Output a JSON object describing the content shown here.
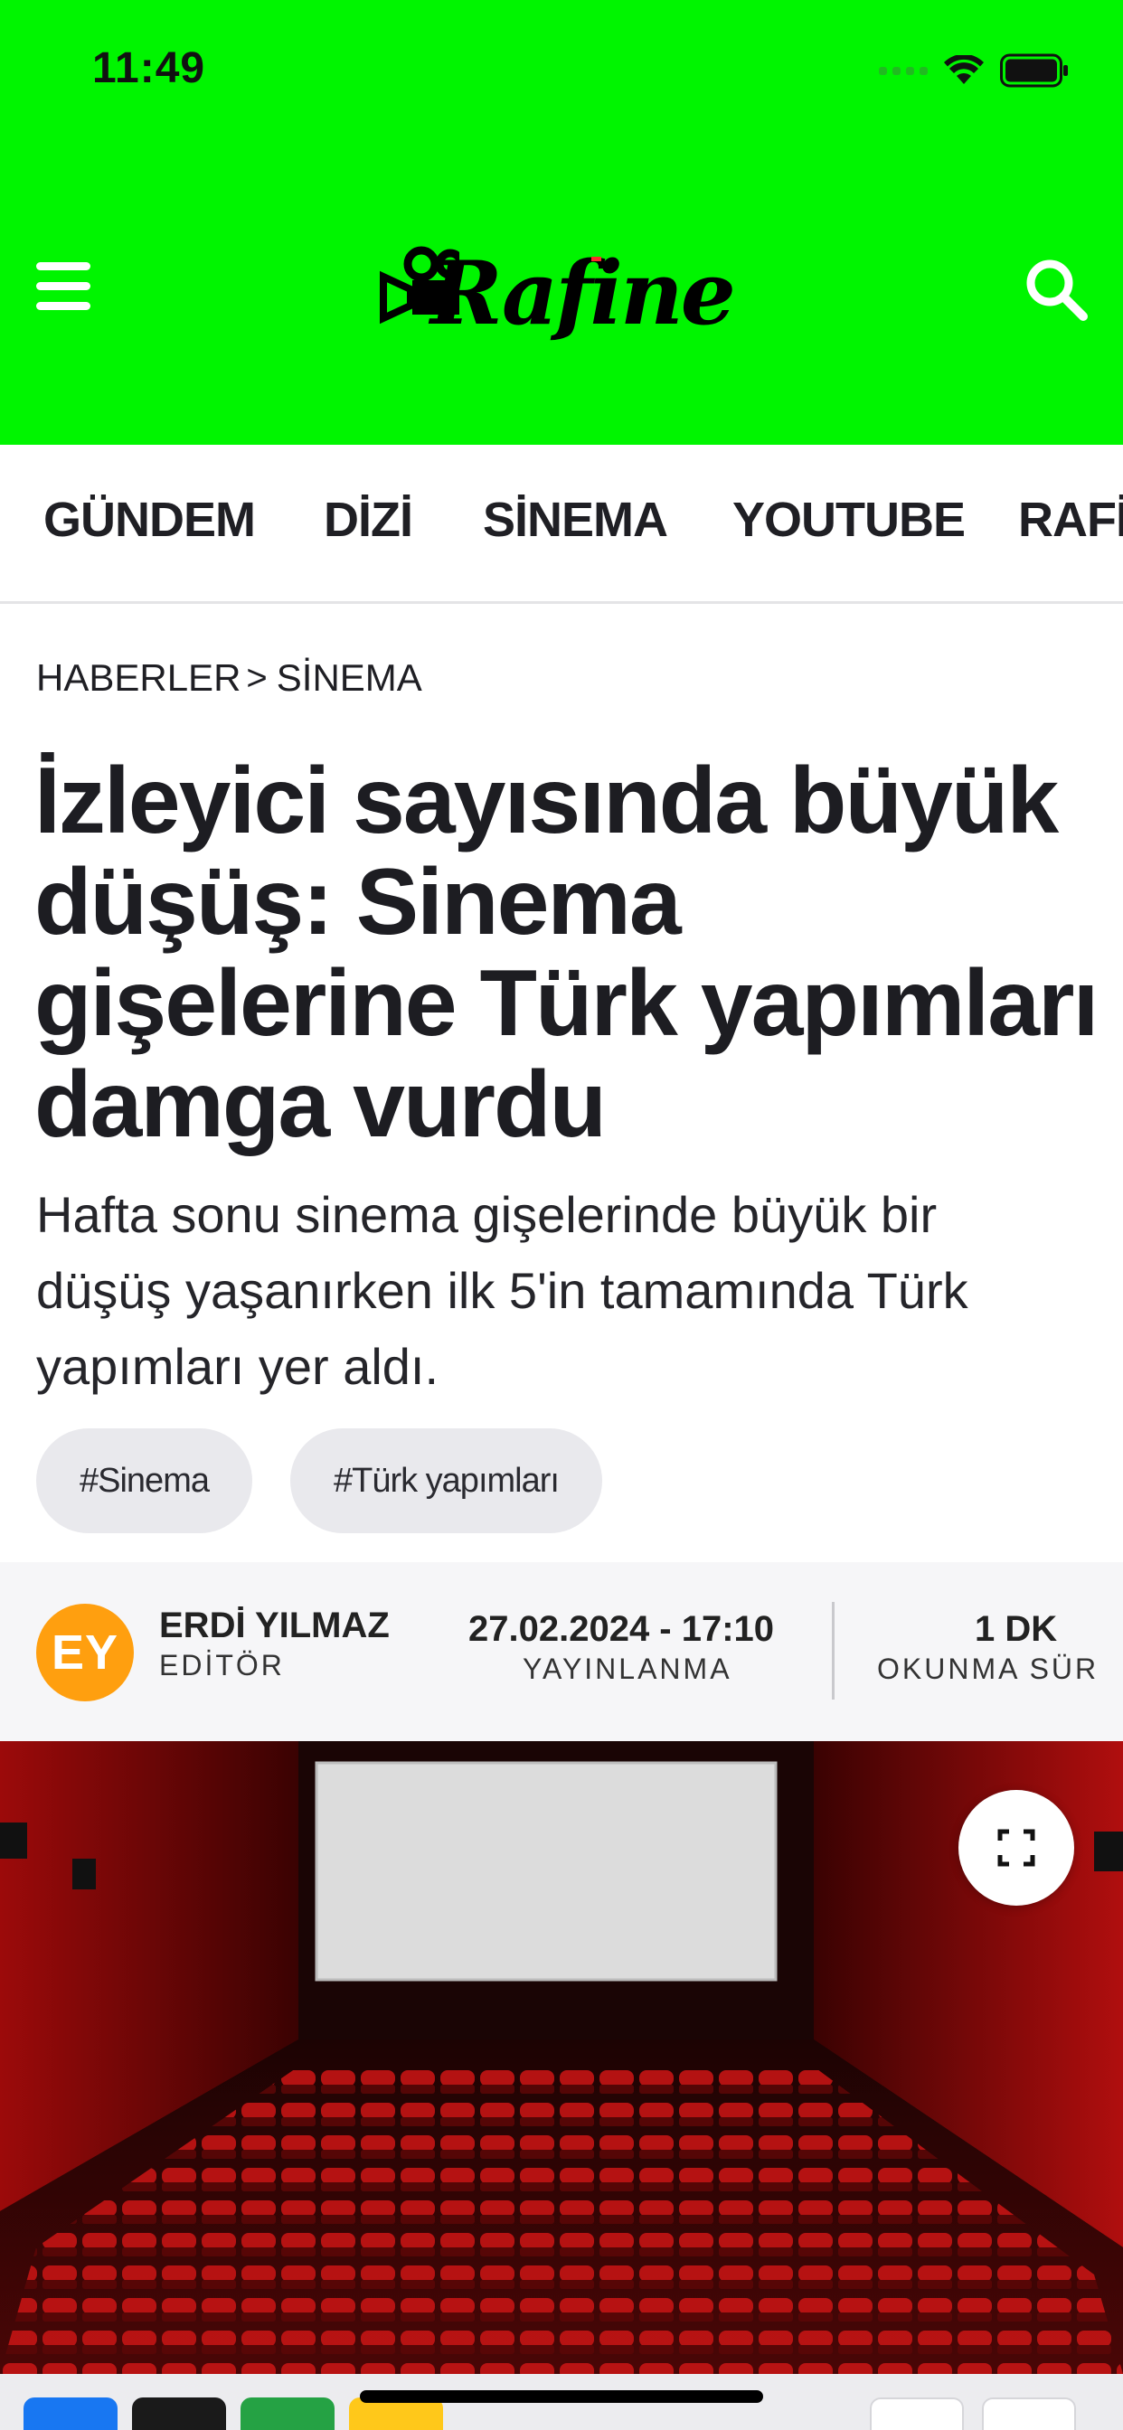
{
  "status_bar": {
    "time": "11:49"
  },
  "header": {
    "menu_icon": "hamburger-menu-icon",
    "logo_text": "Rafine",
    "search_icon": "search-icon",
    "background": "#00f500"
  },
  "categories": [
    "GÜNDEM",
    "DİZİ",
    "SİNEMA",
    "YOUTUBE",
    "RAFİ"
  ],
  "breadcrumb": {
    "root": "HABERLER",
    "separator": ">",
    "current": "SİNEMA"
  },
  "article": {
    "title": "İzleyici sayısında büyük düşüş: Sinema gişelerine Türk yapımları damga vurdu",
    "spot": "Hafta sonu sinema gişelerinde büyük bir düşüş yaşanırken ilk 5'in tamamında Türk yapımları yer aldı.",
    "tags": [
      "#Sinema",
      "#Türk yapımları"
    ]
  },
  "author": {
    "initials": "EY",
    "name": "ERDİ YILMAZ",
    "role": "EDİTÖR",
    "avatar_color": "#ff9f0f"
  },
  "meta": {
    "date": "27.02.2024 - 17:10",
    "date_label": "YAYINLANMA",
    "read_time": "1 DK",
    "read_label": "OKUNMA SÜR"
  },
  "hero": {
    "expand_icon": "fullscreen-expand-icon"
  },
  "share": {
    "buttons": [
      {
        "icon": "facebook-icon",
        "color": "#1877f2"
      },
      {
        "icon": "x-twitter-icon",
        "color": "#1a1a1a"
      },
      {
        "icon": "whatsapp-icon",
        "color": "#25a244"
      },
      {
        "icon": "add-icon",
        "color": "#ffc81a"
      }
    ],
    "right_buttons": [
      {
        "icon": "font-size-icon"
      },
      {
        "icon": "font-increase-icon"
      }
    ]
  }
}
